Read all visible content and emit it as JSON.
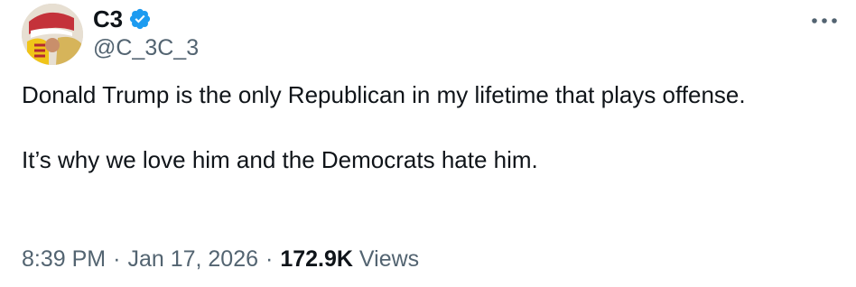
{
  "author": {
    "display_name": "C3",
    "handle": "@C_3C_3",
    "verified": true,
    "verified_color": "#1d9bf0"
  },
  "tweet": {
    "paragraphs": [
      "Donald Trump is the only Republican in my lifetime that plays offense.",
      "It’s why we love him and the Democrats hate him."
    ]
  },
  "meta": {
    "time": "8:39 PM",
    "separator": "·",
    "date": "Jan 17, 2026",
    "views_count": "172.9K",
    "views_label": "Views"
  },
  "icons": {
    "more": "more-horizontal-icon",
    "verified": "verified-badge-icon"
  }
}
